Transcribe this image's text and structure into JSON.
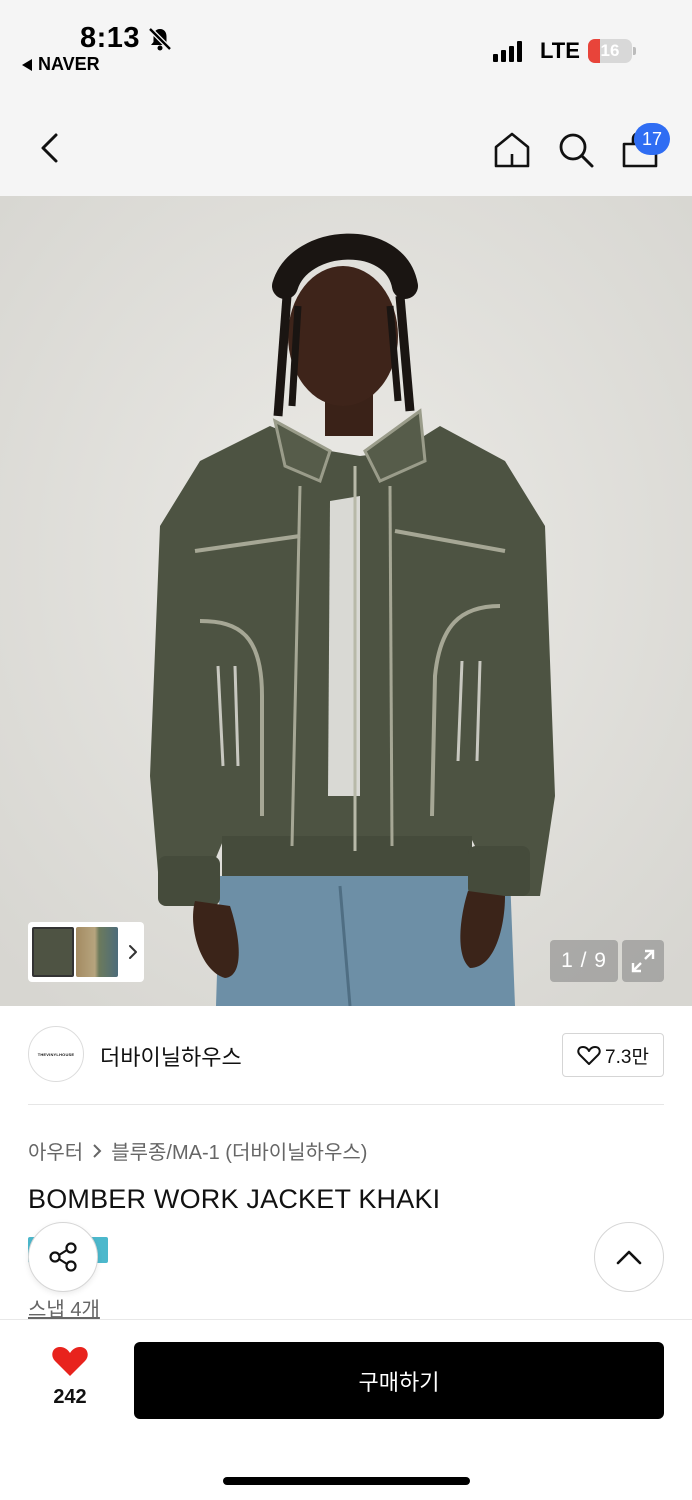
{
  "status_bar": {
    "time": "8:13",
    "back_app": "NAVER",
    "network": "LTE",
    "battery": "16",
    "icons": [
      "bell-slash-icon",
      "signal-icon",
      "battery-icon"
    ]
  },
  "nav": {
    "icons": [
      "back-chevron-icon",
      "home-icon",
      "search-icon",
      "cart-icon"
    ],
    "cart_count": "17"
  },
  "gallery": {
    "counter": "1 / 9",
    "icons": [
      "expand-icon",
      "chevron-right-icon"
    ]
  },
  "brand": {
    "logo_text": "THEVINYLHOUSE",
    "name": "더바이닐하우스",
    "likes": "7.3만"
  },
  "product": {
    "category": "아우터",
    "subcategory": "블루종/MA-1 (더바이닐하우스)",
    "title": "BOMBER WORK JACKET KHAKI",
    "snap": "스냅 4개"
  },
  "bottom": {
    "like_count": "242",
    "buy_label": "구매하기"
  },
  "colors": {
    "accent_badge": "#2f6df3",
    "like_red": "#e8231d",
    "tag_teal": "#4cb8cc",
    "buy_black": "#000000"
  }
}
